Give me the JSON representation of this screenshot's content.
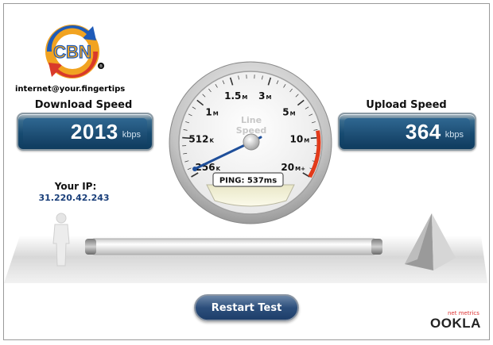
{
  "logo": {
    "text": "CBN",
    "tagline": "internet@your.fingertips"
  },
  "download": {
    "label": "Download Speed",
    "value": "2013",
    "unit": "kbps"
  },
  "upload": {
    "label": "Upload Speed",
    "value": "364",
    "unit": "kbps"
  },
  "ip": {
    "label": "Your IP:",
    "value": "31.220.42.243"
  },
  "gauge": {
    "center_label_line1": "Line",
    "center_label_line2": "Speed",
    "ping_text": "PING: 537ms",
    "ticks": [
      {
        "main": "256",
        "suffix": "K"
      },
      {
        "main": "512",
        "suffix": "K"
      },
      {
        "main": "1",
        "suffix": "M"
      },
      {
        "main": "1.5",
        "suffix": "M"
      },
      {
        "main": "3",
        "suffix": "M"
      },
      {
        "main": "5",
        "suffix": "M"
      },
      {
        "main": "10",
        "suffix": "M"
      },
      {
        "main": "20",
        "suffix": "M+"
      }
    ]
  },
  "restart_label": "Restart Test",
  "ookla": {
    "tag": "net metrics",
    "brand": "OOKLA"
  },
  "colors": {
    "panel": "#174b71",
    "ip_text": "#1a3f7a",
    "redline": "#e23a1a",
    "needle": "#1f4f9a"
  }
}
